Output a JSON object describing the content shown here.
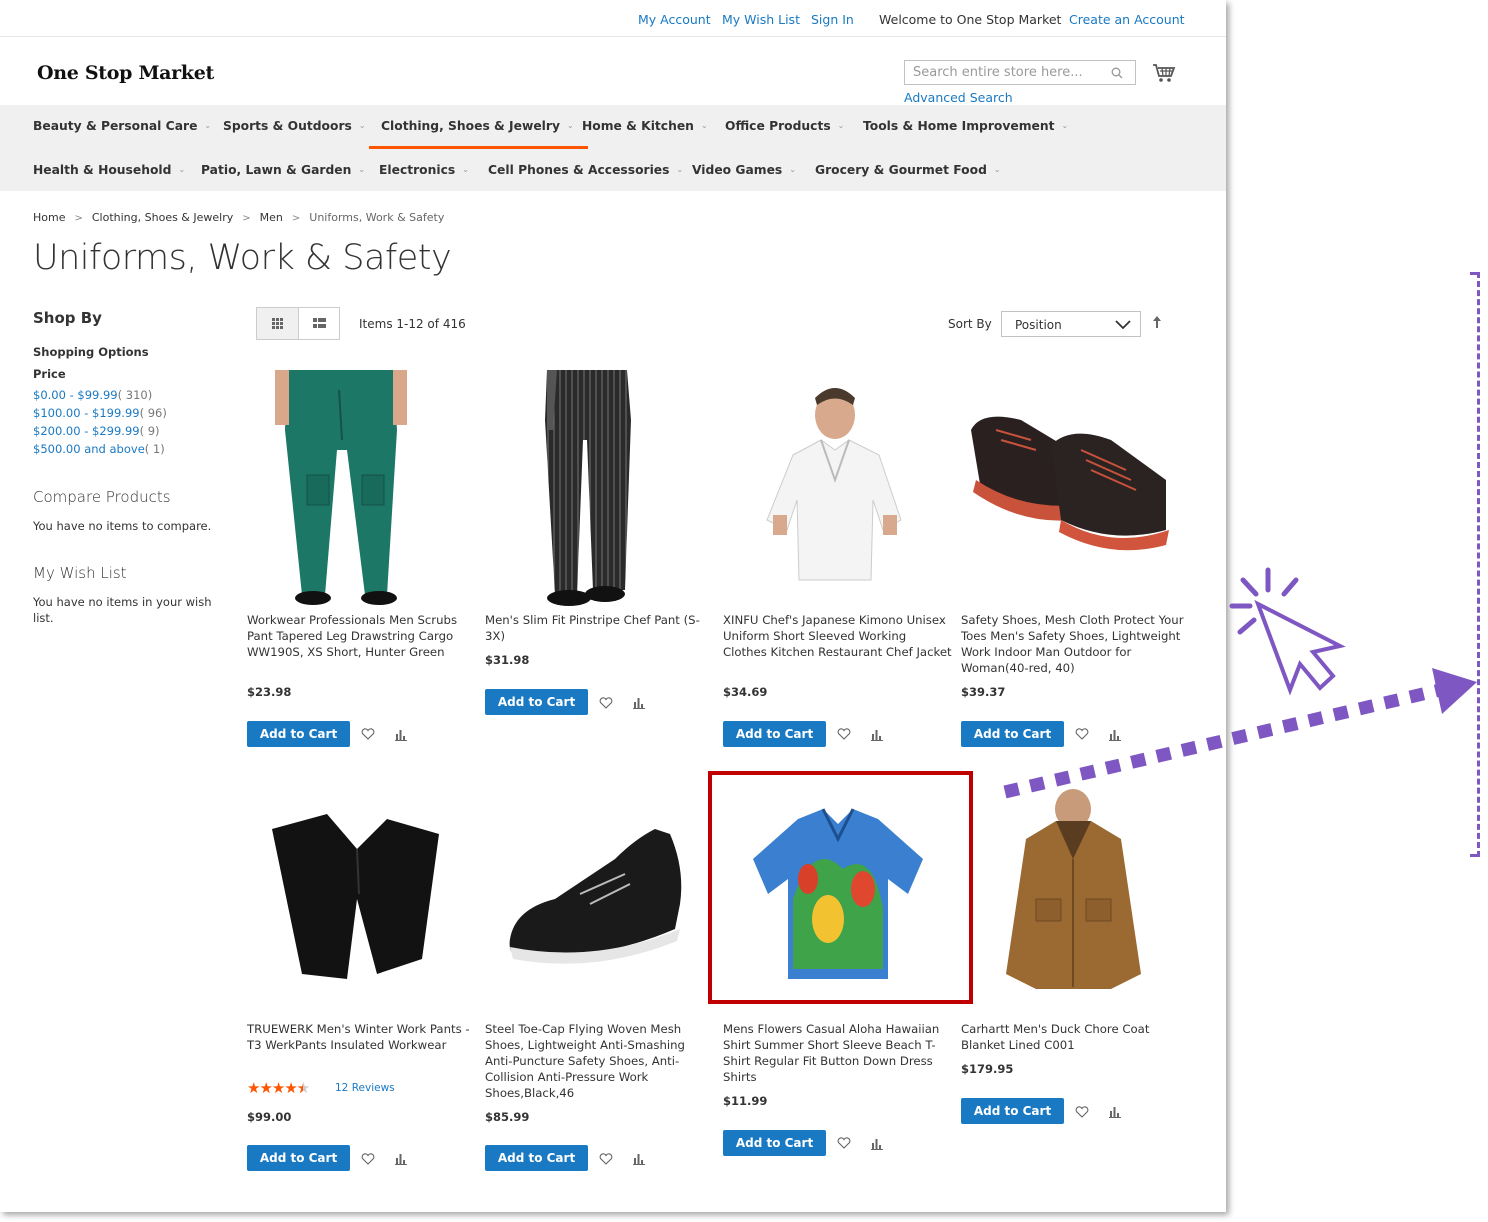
{
  "topbar": {
    "my_account": "My Account",
    "my_wish_list": "My Wish List",
    "sign_in": "Sign In",
    "welcome": "Welcome to One Stop Market",
    "create_account": "Create an Account"
  },
  "header": {
    "logo": "One Stop Market",
    "search_placeholder": "Search entire store here...",
    "advanced_search": "Advanced Search"
  },
  "nav": {
    "row1": [
      "Beauty & Personal Care",
      "Sports & Outdoors",
      "Clothing, Shoes & Jewelry",
      "Home & Kitchen",
      "Office Products",
      "Tools & Home Improvement"
    ],
    "row2": [
      "Health & Household",
      "Patio, Lawn & Garden",
      "Electronics",
      "Cell Phones & Accessories",
      "Video Games",
      "Grocery & Gourmet Food"
    ],
    "active": "Clothing, Shoes & Jewelry"
  },
  "breadcrumb": [
    "Home",
    "Clothing, Shoes & Jewelry",
    "Men",
    "Uniforms, Work & Safety"
  ],
  "page_title": "Uniforms, Work & Safety",
  "sidebar": {
    "shop_by": "Shop By",
    "shopping_options": "Shopping Options",
    "price_label": "Price",
    "price_ranges": [
      {
        "label": "$0.00 - $99.99",
        "count": "( 310)"
      },
      {
        "label": "$100.00 - $199.99",
        "count": "( 96)"
      },
      {
        "label": "$200.00 - $299.99",
        "count": "( 9)"
      },
      {
        "label": "$500.00 and above",
        "count": "( 1)"
      }
    ],
    "compare_title": "Compare Products",
    "compare_text": "You have no items to compare.",
    "wishlist_title": "My Wish List",
    "wishlist_text": "You have no items in your wish list."
  },
  "toolbar": {
    "items_count": "Items 1-12 of 416",
    "sort_label": "Sort By",
    "sort_value": "Position"
  },
  "products": [
    {
      "name": "Workwear Professionals Men Scrubs Pant Tapered Leg Drawstring Cargo WW190S, XS Short, Hunter Green",
      "price": "$23.98",
      "image": "green-pants"
    },
    {
      "name": "Men's Slim Fit Pinstripe Chef Pant (S-3X)",
      "price": "$31.98",
      "image": "pinstripe-pants"
    },
    {
      "name": "XINFU Chef's Japanese Kimono Unisex Uniform Short Sleeved Working Clothes Kitchen Restaurant Chef Jacket",
      "price": "$34.69",
      "image": "chef-jacket"
    },
    {
      "name": "Safety Shoes, Mesh Cloth Protect Your Toes Men's Safety Shoes, Lightweight Work Indoor Man Outdoor for Woman(40-red, 40)",
      "price": "$39.37",
      "image": "safety-shoes"
    },
    {
      "name": "TRUEWERK Men's Winter Work Pants - T3 WerkPants Insulated Workwear",
      "price": "$99.00",
      "image": "black-pants",
      "rating": 4.5,
      "reviews": "12  Reviews"
    },
    {
      "name": "Steel Toe-Cap Flying Woven Mesh Shoes, Lightweight Anti-Smashing Anti-Puncture Safety Shoes, Anti-Collision Anti-Pressure Work Shoes,Black,46",
      "price": "$85.99",
      "image": "black-sneaker"
    },
    {
      "name": "Mens Flowers Casual Aloha Hawaiian Shirt Summer Short Sleeve Beach T-Shirt Regular Fit Button Down Dress Shirts",
      "price": "$11.99",
      "image": "hawaiian-shirt"
    },
    {
      "name": "Carhartt Men's Duck Chore Coat Blanket Lined C001",
      "price": "$179.95",
      "image": "brown-coat"
    }
  ],
  "add_to_cart": "Add to Cart",
  "colors": {
    "link": "#1979c3",
    "button": "#1979c3",
    "accent": "#ff5501",
    "highlight": "#c00000",
    "pointer": "#7e57c2"
  }
}
